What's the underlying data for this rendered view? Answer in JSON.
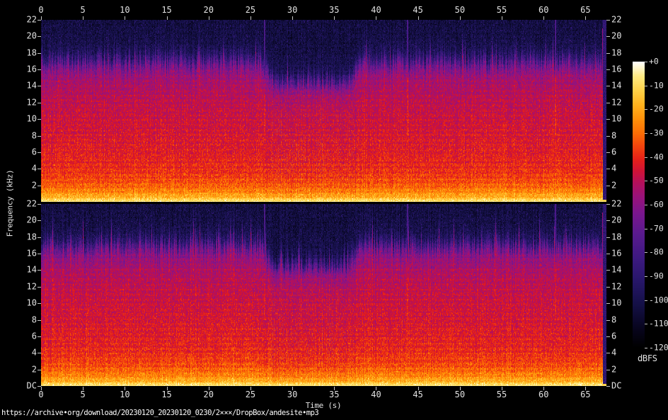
{
  "page": {
    "background": "#000000",
    "url_text": "https://archive•org/download/20230120_20230120_0230/2×××/DropBox/andesite•mp3"
  },
  "chart_data": {
    "type": "heatmap",
    "subtype": "audio-spectrogram",
    "title": "",
    "xlabel": "Time (s)",
    "ylabel": "Frequency (kHz)",
    "legend_position": "right-colorbar",
    "grid": false,
    "channels": [
      "channel-1-top",
      "channel-2-bottom"
    ],
    "x_range_s": [
      0,
      67.5
    ],
    "x_tick_labels": [
      "0",
      "5",
      "10",
      "15",
      "20",
      "25",
      "30",
      "35",
      "40",
      "45",
      "50",
      "55",
      "60",
      "65"
    ],
    "x_tick_values_s": [
      0,
      5,
      10,
      15,
      20,
      25,
      30,
      35,
      40,
      45,
      50,
      55,
      60,
      65
    ],
    "y_range_khz": [
      0,
      22
    ],
    "y_tick_labels_channel1": [
      "22",
      "20",
      "18",
      "16",
      "14",
      "12",
      "10",
      "8",
      "6",
      "4",
      "2"
    ],
    "y_tick_values_channel1_khz": [
      22,
      20,
      18,
      16,
      14,
      12,
      10,
      8,
      6,
      4,
      2
    ],
    "y_tick_labels_channel2": [
      "22",
      "20",
      "18",
      "16",
      "14",
      "12",
      "10",
      "8",
      "6",
      "4",
      "2",
      "DC"
    ],
    "y_tick_values_channel2_khz": [
      22,
      20,
      18,
      16,
      14,
      12,
      10,
      8,
      6,
      4,
      2,
      0
    ],
    "colorbar": {
      "label": "dBFS",
      "tick_labels": [
        "+0",
        "-10",
        "-20",
        "-30",
        "-40",
        "-50",
        "-60",
        "-70",
        "-80",
        "-90",
        "-100",
        "-110",
        "-120"
      ],
      "tick_values_db": [
        0,
        -10,
        -20,
        -30,
        -40,
        -50,
        -60,
        -70,
        -80,
        -90,
        -100,
        -110,
        -120
      ],
      "range_db": [
        -120,
        0
      ],
      "palette_stops": [
        [
          0.0,
          "#000000"
        ],
        [
          0.07,
          "#08051f"
        ],
        [
          0.15,
          "#141046"
        ],
        [
          0.23,
          "#261668"
        ],
        [
          0.31,
          "#3c1980"
        ],
        [
          0.4,
          "#5a1a8e"
        ],
        [
          0.47,
          "#7a168e"
        ],
        [
          0.53,
          "#9a1279"
        ],
        [
          0.58,
          "#b61058"
        ],
        [
          0.62,
          "#d01334"
        ],
        [
          0.66,
          "#e62118"
        ],
        [
          0.71,
          "#f4480c"
        ],
        [
          0.75,
          "#fb6d05"
        ],
        [
          0.8,
          "#fe9009"
        ],
        [
          0.85,
          "#ffb21d"
        ],
        [
          0.9,
          "#ffd148"
        ],
        [
          0.95,
          "#ffea82"
        ],
        [
          1.0,
          "#ffffff"
        ]
      ]
    },
    "render": {
      "profile_khz_db": [
        [
          0.0,
          -7
        ],
        [
          0.2,
          -11
        ],
        [
          0.6,
          -19
        ],
        [
          1.2,
          -26
        ],
        [
          2.0,
          -32
        ],
        [
          3.0,
          -37
        ],
        [
          4.5,
          -41
        ],
        [
          7.0,
          -44
        ],
        [
          10.0,
          -47
        ],
        [
          12.5,
          -50
        ],
        [
          14.0,
          -53
        ],
        [
          15.2,
          -57
        ],
        [
          16.1,
          -63
        ],
        [
          16.7,
          -73
        ],
        [
          17.3,
          -86
        ],
        [
          18.0,
          -96
        ],
        [
          19.0,
          -101
        ],
        [
          20.5,
          -103
        ],
        [
          22.0,
          -104
        ]
      ],
      "hf_cutoff_khz": 16.5,
      "hf_dropout": {
        "start_s": 26.3,
        "end_s": 38.2,
        "depth_khz": 2.4
      },
      "comb_striping_s": [
        26.8,
        37.6
      ],
      "event_times_s": [
        26.6,
        43.7,
        61.3
      ],
      "end_time_s": 67.05,
      "channel_seeds": [
        11,
        57
      ]
    },
    "description": "Two-channel (stereo) audio spectrogram, 0–22 kHz over ~67.5 s. Broadband energy: bright yellow near DC, red/orange through midrange, sharp rolloff near 16.5 kHz into dark navy noise floor; high-frequency dropout around 26–38 s; sparse vertical event lines; signal ends ~67.2 s."
  }
}
